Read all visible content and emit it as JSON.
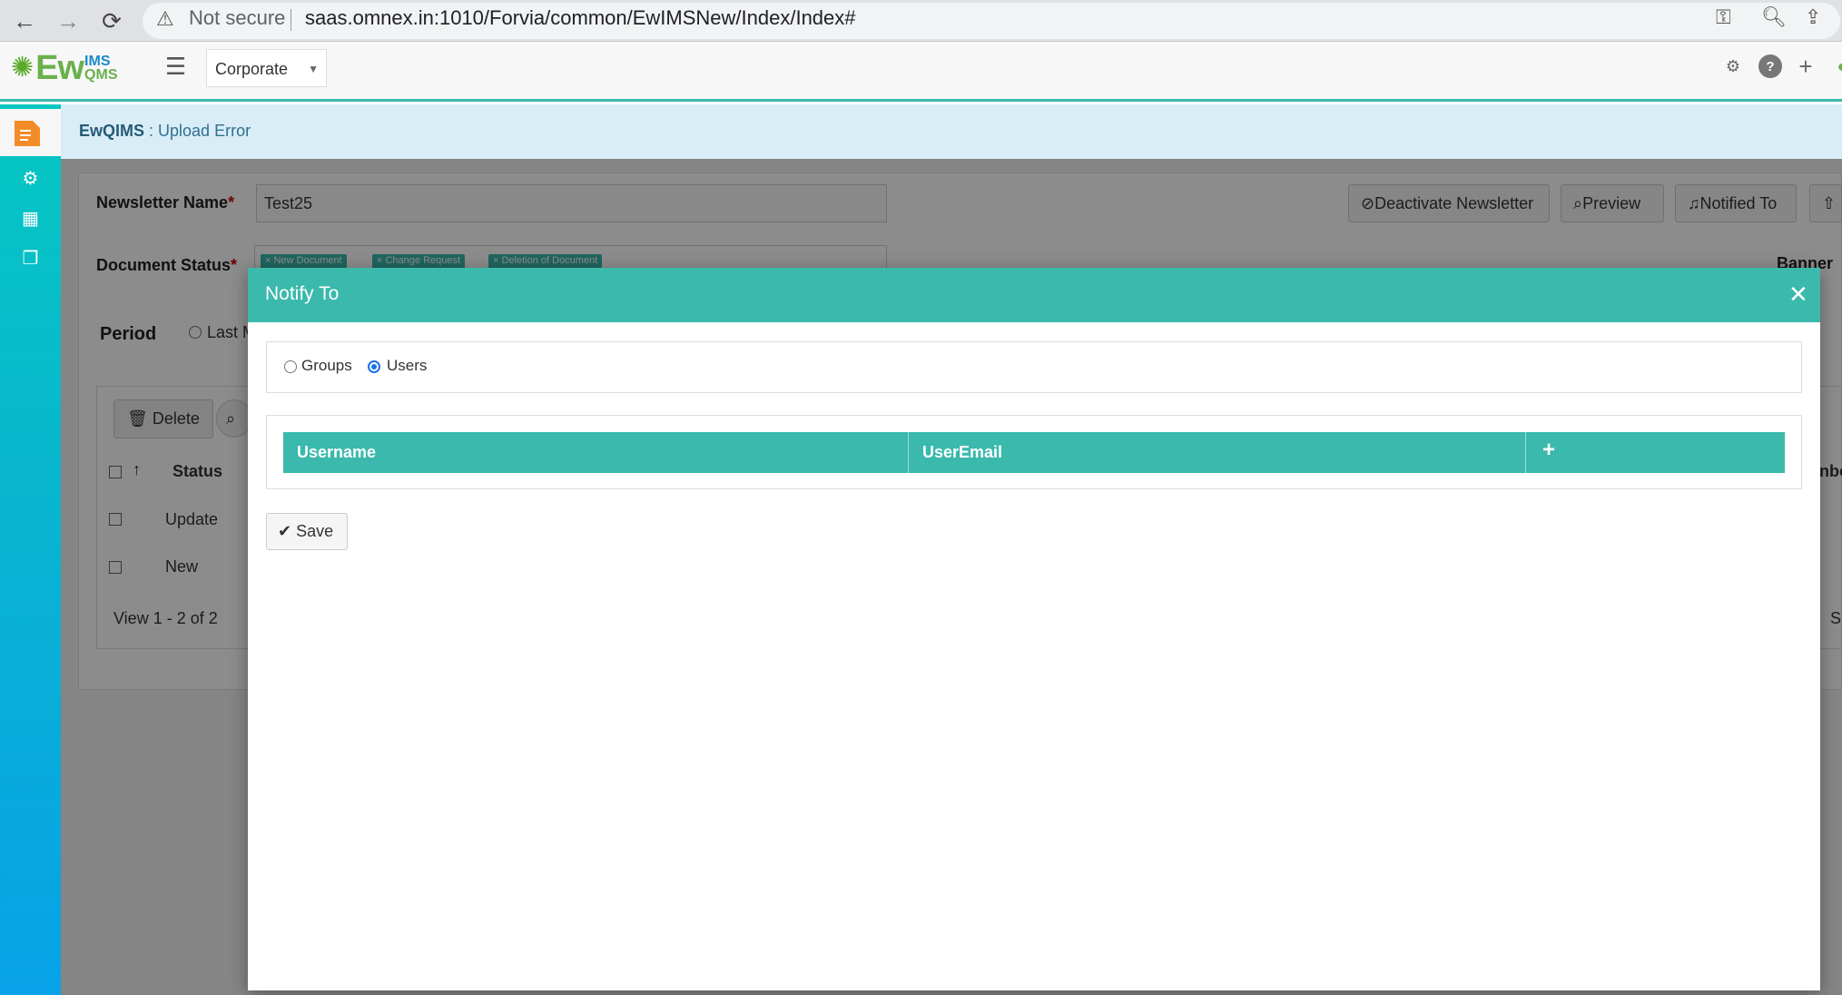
{
  "browser": {
    "security_label": "Not secure",
    "url": "saas.omnex.in:1010/Forvia/common/EwIMSNew/Index/Index#"
  },
  "header": {
    "logo_main": "Ew",
    "logo_top": "IMS",
    "logo_bottom": "QMS",
    "site_selector": "Corporate"
  },
  "breadcrumb": {
    "module": "EwQIMS",
    "separator": " : ",
    "page": "Upload Error"
  },
  "form": {
    "newsletter_label": "Newsletter Name",
    "newsletter_value": "Test25",
    "doc_status_label": "Document Status",
    "doc_status_tags": [
      "× New Document",
      "× Change Request",
      "× Deletion of Document"
    ],
    "period_label": "Period",
    "period_option": "Last M",
    "banner_label": "Banner",
    "buttons": {
      "deactivate": "Deactivate Newsletter",
      "preview": "Preview",
      "notified_to": "Notified To"
    }
  },
  "grid": {
    "delete_label": "Delete",
    "columns": [
      "Status"
    ],
    "rows": [
      {
        "status": "Update"
      },
      {
        "status": "New"
      }
    ],
    "pager": "View 1 - 2 of 2",
    "right_col_fragment": "nbe",
    "right_pager_fragment": "Sl"
  },
  "modal": {
    "title": "Notify To",
    "radio_groups": "Groups",
    "radio_users": "Users",
    "selected": "Users",
    "columns": [
      "Username",
      "UserEmail"
    ],
    "save_label": "Save"
  },
  "colors": {
    "accent": "#3ab9ac",
    "breadcrumb_bg": "#d9edf7"
  }
}
